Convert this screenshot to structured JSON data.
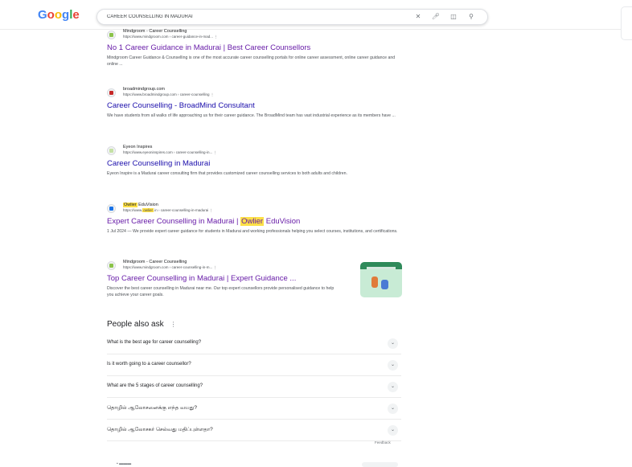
{
  "header": {
    "logo": [
      "G",
      "o",
      "o",
      "g",
      "l",
      "e"
    ],
    "query": "CAREER COUNSELLING IN MADURAI",
    "icons": [
      "close-icon",
      "mic-icon",
      "lens-icon",
      "search-icon"
    ]
  },
  "results": [
    {
      "site": "Mindgroom - Career Counselling",
      "url": "https://www.mindgroom.com › career-guidance-in-mad... ⋮",
      "title": "No 1 Career Guidance in Madurai | Best Career Counsellors",
      "snippet": "Mindgroom Career Guidance & Counselling is one of the most accurate career counselling portals for online career assessment, online career guidance and online ...",
      "favicon_color": "#8bc34a",
      "visited": true
    },
    {
      "site": "broadmindgroup.com",
      "url": "https://www.broadmindgroup.com › career-counselling ⋮",
      "title": "Career Counselling - BroadMind Consultant",
      "snippet": "We have students from all walks of life approaching us for their career guidance. The BroadMind team has vast industrial experience as its members have ...",
      "favicon_color": "#1e3a8a",
      "visited": false
    },
    {
      "site": "Eyeon Inspires",
      "url": "https://www.eyeoninspires.com › career-counselling-in... ⋮",
      "title": "Career Counselling in Madurai",
      "snippet": "Eyeon Inspire is a Madurai career consulting firm that provides customized career counselling services to both adults and children.",
      "favicon_color": "#c5e1a5",
      "visited": false
    },
    {
      "site_hl": "Owlier",
      "site": " EduVision",
      "url_pre": "https://www.",
      "url_hl": "owlier",
      "url_post": ".in › career-counselling-in-madurai ⋮",
      "title_pre": "Expert Career Counselling in Madurai | ",
      "title_hl": "Owlier",
      "title_post": " EduVision",
      "snippet": "1 Jul 2024 — We provide expert career guidance for students in Madurai and working professionals helping you select courses, institutions, and certifications.",
      "favicon_color": "#1a73e8",
      "visited": true
    },
    {
      "site": "Mindgroom - Career Counselling",
      "url": "https://www.mindgroom.com › career-counselling-in-m... ⋮",
      "title": "Top Career Counselling in Madurai | Expert Guidance ...",
      "snippet": "Discover the best career counselling in Madurai near me. Our top expert counsellors provide personalised guidance to help you achieve your career goals.",
      "favicon_color": "#8bc34a",
      "visited": true
    }
  ],
  "people_also_ask": {
    "heading": "People also ask",
    "questions": [
      "What is the best age for career counselling?",
      "Is it worth going to a career counsellor?",
      "What are the 5 stages of career counselling?",
      "தொழில் ஆலோசனைக்கு எந்த வயது?",
      "தொழில் ஆலோசகர் செல்வது மதிப்புள்ளதா?"
    ]
  },
  "feedback": "Feedback"
}
